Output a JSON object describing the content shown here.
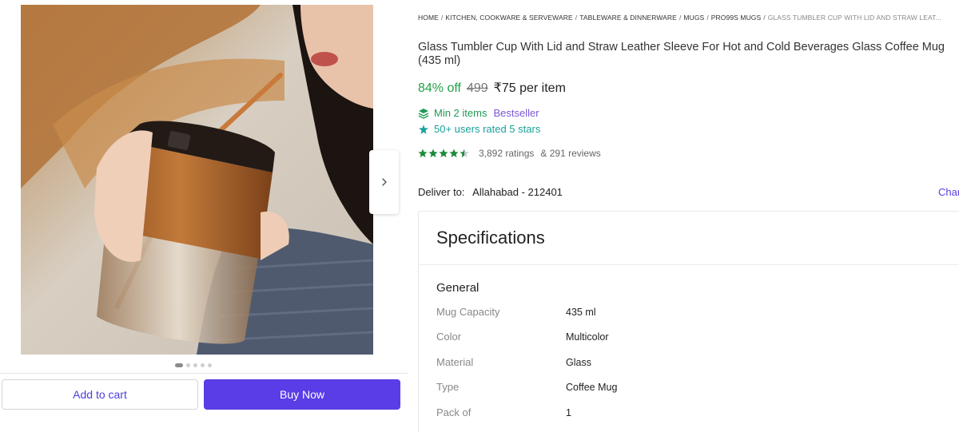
{
  "breadcrumb": {
    "items": [
      "HOME",
      "KITCHEN, COOKWARE & SERVEWARE",
      "TABLEWARE & DINNERWARE",
      "MUGS",
      "PRO99S MUGS"
    ],
    "separator": "/",
    "current": "GLASS TUMBLER CUP WITH LID AND STRAW LEAT..."
  },
  "product": {
    "title": "Glass Tumbler Cup With Lid and Straw Leather Sleeve For Hot and Cold Beverages Glass Coffee Mug (435 ml)",
    "discount": "84% off",
    "mrp": "499",
    "price": "₹75 per item",
    "min_items": "Min 2 items",
    "badge": "Bestseller",
    "rated": "50+ users rated 5 stars",
    "rating_stars": 4.5,
    "ratings_count": "3,892 ratings",
    "reviews_count": "& 291 reviews"
  },
  "delivery": {
    "label": "Deliver to:",
    "place": "Allahabad - 212401",
    "change": "Change"
  },
  "gallery": {
    "dots_total": 5,
    "active_dot": 0,
    "next_icon": "chevron-right-icon"
  },
  "actions": {
    "add_to_cart": "Add to cart",
    "buy_now": "Buy Now"
  },
  "specifications": {
    "title": "Specifications",
    "group": "General",
    "rows": [
      {
        "key": "Mug Capacity",
        "value": "435 ml"
      },
      {
        "key": "Color",
        "value": "Multicolor"
      },
      {
        "key": "Material",
        "value": "Glass"
      },
      {
        "key": "Type",
        "value": "Coffee Mug"
      },
      {
        "key": "Pack of",
        "value": "1"
      }
    ]
  },
  "colors": {
    "accent": "#5a3de6",
    "discount_green": "#23a047",
    "star_green": "#1e8a3a",
    "bestseller_purple": "#7b57d6",
    "rated_teal": "#1aa19a"
  },
  "icons": {
    "layers": "layers-icon",
    "sparkle": "sparkle-icon",
    "star": "star-icon",
    "chevron": "chevron-right-icon"
  }
}
